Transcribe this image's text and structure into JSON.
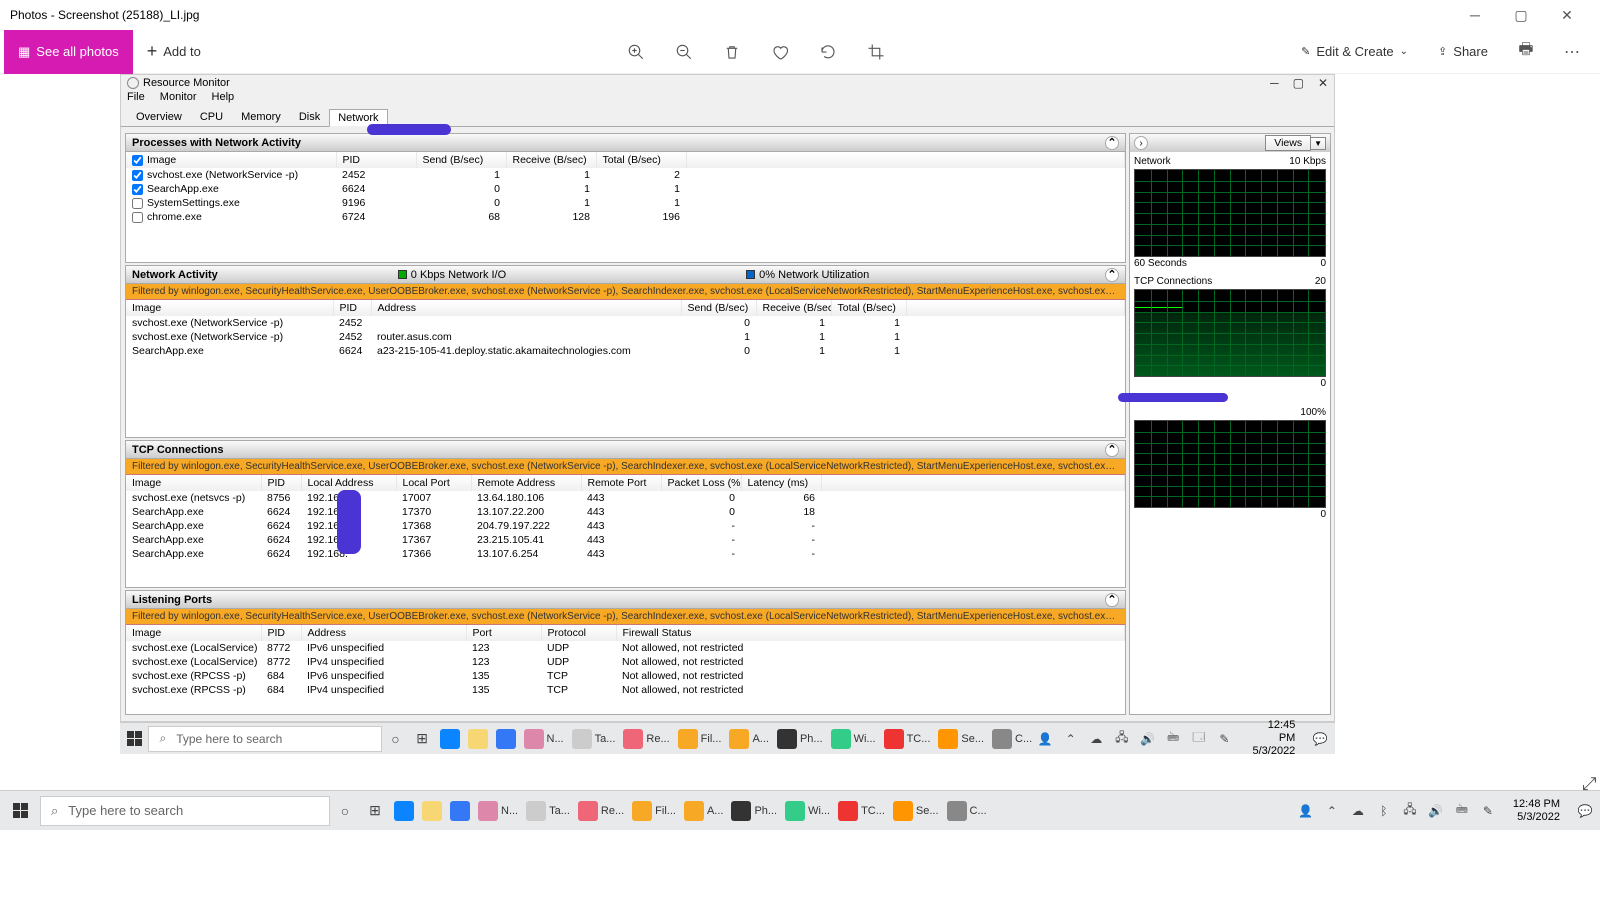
{
  "photos": {
    "title": "Photos - Screenshot (25188)_LI.jpg",
    "see_all": "See all photos",
    "add_to": "Add to",
    "edit_create": "Edit & Create",
    "share": "Share"
  },
  "resmon": {
    "title": "Resource Monitor",
    "menu": {
      "file": "File",
      "monitor": "Monitor",
      "help": "Help"
    },
    "tabs": {
      "overview": "Overview",
      "cpu": "CPU",
      "memory": "Memory",
      "disk": "Disk",
      "network": "Network"
    }
  },
  "panels": {
    "pwna": {
      "title": "Processes with Network Activity",
      "cols": {
        "image": "Image",
        "pid": "PID",
        "send": "Send (B/sec)",
        "recv": "Receive (B/sec)",
        "total": "Total (B/sec)"
      },
      "rows": [
        {
          "chk": true,
          "image": "svchost.exe (NetworkService -p)",
          "pid": "2452",
          "send": "1",
          "recv": "1",
          "total": "2"
        },
        {
          "chk": true,
          "image": "SearchApp.exe",
          "pid": "6624",
          "send": "0",
          "recv": "1",
          "total": "1"
        },
        {
          "chk": false,
          "image": "SystemSettings.exe",
          "pid": "9196",
          "send": "0",
          "recv": "1",
          "total": "1"
        },
        {
          "chk": false,
          "image": "chrome.exe",
          "pid": "6724",
          "send": "68",
          "recv": "128",
          "total": "196"
        }
      ]
    },
    "na": {
      "title": "Network Activity",
      "legend1": "0 Kbps Network I/O",
      "legend2": "0% Network Utilization",
      "filter": "Filtered by winlogon.exe, SecurityHealthService.exe, UserOOBEBroker.exe, svchost.exe (NetworkService -p), SearchIndexer.exe, svchost.exe (LocalServiceNetworkRestricted), StartMenuExperienceHost.exe, svchost.exe (LocalServiceNetworkR...",
      "cols": {
        "image": "Image",
        "pid": "PID",
        "address": "Address",
        "send": "Send (B/sec)",
        "recv": "Receive (B/sec)",
        "total": "Total (B/sec)"
      },
      "rows": [
        {
          "image": "svchost.exe (NetworkService -p)",
          "pid": "2452",
          "address": "",
          "send": "0",
          "recv": "1",
          "total": "1"
        },
        {
          "image": "svchost.exe (NetworkService -p)",
          "pid": "2452",
          "address": "router.asus.com",
          "send": "1",
          "recv": "1",
          "total": "1"
        },
        {
          "image": "SearchApp.exe",
          "pid": "6624",
          "address": "a23-215-105-41.deploy.static.akamaitechnologies.com",
          "send": "0",
          "recv": "1",
          "total": "1"
        }
      ]
    },
    "tcp": {
      "title": "TCP Connections",
      "filter": "Filtered by winlogon.exe, SecurityHealthService.exe, UserOOBEBroker.exe, svchost.exe (NetworkService -p), SearchIndexer.exe, svchost.exe (LocalServiceNetworkRestricted), StartMenuExperienceHost.exe, svchost.exe (LocalServiceNetworkR...",
      "cols": {
        "image": "Image",
        "pid": "PID",
        "laddr": "Local Address",
        "lport": "Local Port",
        "raddr": "Remote Address",
        "rport": "Remote Port",
        "loss": "Packet Loss (%)",
        "lat": "Latency (ms)"
      },
      "rows": [
        {
          "image": "svchost.exe (netsvcs -p)",
          "pid": "8756",
          "laddr": "192.168.",
          "lport": "17007",
          "raddr": "13.64.180.106",
          "rport": "443",
          "loss": "0",
          "lat": "66"
        },
        {
          "image": "SearchApp.exe",
          "pid": "6624",
          "laddr": "192.168.",
          "lport": "17370",
          "raddr": "13.107.22.200",
          "rport": "443",
          "loss": "0",
          "lat": "18"
        },
        {
          "image": "SearchApp.exe",
          "pid": "6624",
          "laddr": "192.168.",
          "lport": "17368",
          "raddr": "204.79.197.222",
          "rport": "443",
          "loss": "-",
          "lat": "-"
        },
        {
          "image": "SearchApp.exe",
          "pid": "6624",
          "laddr": "192.168.",
          "lport": "17367",
          "raddr": "23.215.105.41",
          "rport": "443",
          "loss": "-",
          "lat": "-"
        },
        {
          "image": "SearchApp.exe",
          "pid": "6624",
          "laddr": "192.168.",
          "lport": "17366",
          "raddr": "13.107.6.254",
          "rport": "443",
          "loss": "-",
          "lat": "-"
        }
      ]
    },
    "lp": {
      "title": "Listening Ports",
      "filter": "Filtered by winlogon.exe, SecurityHealthService.exe, UserOOBEBroker.exe, svchost.exe (NetworkService -p), SearchIndexer.exe, svchost.exe (LocalServiceNetworkRestricted), StartMenuExperienceHost.exe, svchost.exe (LocalServiceNetworkR...",
      "cols": {
        "image": "Image",
        "pid": "PID",
        "address": "Address",
        "port": "Port",
        "proto": "Protocol",
        "fw": "Firewall Status"
      },
      "rows": [
        {
          "image": "svchost.exe (LocalService)",
          "pid": "8772",
          "address": "IPv6 unspecified",
          "port": "123",
          "proto": "UDP",
          "fw": "Not allowed, not restricted"
        },
        {
          "image": "svchost.exe (LocalService)",
          "pid": "8772",
          "address": "IPv4 unspecified",
          "port": "123",
          "proto": "UDP",
          "fw": "Not allowed, not restricted"
        },
        {
          "image": "svchost.exe (RPCSS -p)",
          "pid": "684",
          "address": "IPv6 unspecified",
          "port": "135",
          "proto": "TCP",
          "fw": "Not allowed, not restricted"
        },
        {
          "image": "svchost.exe (RPCSS -p)",
          "pid": "684",
          "address": "IPv4 unspecified",
          "port": "135",
          "proto": "TCP",
          "fw": "Not allowed, not restricted"
        }
      ]
    }
  },
  "side": {
    "views": "Views",
    "g1": {
      "title": "Network",
      "right": "10 Kbps",
      "bl": "60 Seconds",
      "br": "0"
    },
    "g2": {
      "title": "TCP Connections",
      "right": "20",
      "br": "0"
    },
    "g3": {
      "right": "100%",
      "br": "0"
    }
  },
  "taskbar": {
    "search_ph": "Type here to search",
    "items": [
      "N...",
      "Ta...",
      "Re...",
      "Fil...",
      "A...",
      "Ph...",
      "Wi...",
      "TC...",
      "Se...",
      "C..."
    ],
    "inner_time": "12:45 PM",
    "inner_date": "5/3/2022",
    "outer_time": "12:48 PM",
    "outer_date": "5/3/2022"
  }
}
